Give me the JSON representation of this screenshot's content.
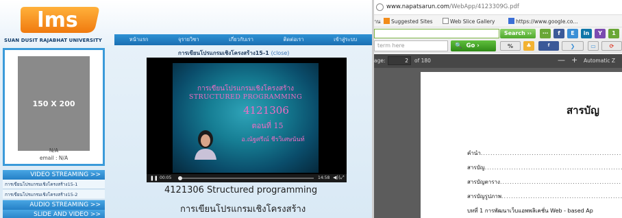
{
  "lms": {
    "logo_text": "lms",
    "university": "SUAN DUSIT RAJABHAT UNIVERSITY",
    "nav": [
      "หน้าแรก",
      "จุรายวิชา",
      "เกี่ยวกับเรา",
      "ติดต่อเรา",
      "เข้าสู่ระบบ"
    ],
    "profile": {
      "placeholder": "150 X 200",
      "name": "N/A",
      "email": "email : N/A"
    },
    "sections": {
      "video_streaming": "VIDEO STREAMING >>",
      "audio_streaming": "AUDIO STREAMING >>",
      "slide_and_video": "SLIDE AND VIDEO >>"
    },
    "video_list": [
      "การเขียนโปรแกรมเชิงโครงสร้าง15-1",
      "การเขียนโปรแกรมเชิงโครงสร้าง15-2"
    ],
    "player": {
      "title": "การเขียนโปรแกรมเชิงโครงสร้าง15-1",
      "close_label": "(close)",
      "slide_lines": [
        "การเขียนโปรแกรมเชิงโครงสร้าง",
        "STRUCTURED PROGRAMMING",
        "4121306",
        "ตอนที่ 15",
        "อ.ณัฐศรีณ์ ชีรวิเศษนันท์"
      ],
      "current_time": "00:05",
      "total_time": "14:58",
      "progress": 0.006
    },
    "course_title_en": "4121306 Structured programming",
    "course_title_th": "การเขียนโปรแกรมเชิงโครงสร้าง"
  },
  "browser": {
    "url_domain": "www.napatsarun.com",
    "url_path": "/WebApp/4123309G.pdf",
    "favorites": [
      "าน",
      "Suggested Sites",
      "Web Slice Gallery",
      "https://www.google.co..."
    ],
    "search_button": "Search",
    "search_placeholder": "term here",
    "go_button": "Go",
    "pdf": {
      "page_label": "age:",
      "page_value": "2",
      "page_total": "of 180",
      "zoom_out": "—",
      "zoom_in": "+",
      "zoom_value": "Automatic Z",
      "heading": "สารบัญ",
      "toc": [
        "คำนำ",
        "สารบัญ",
        "สารบัญตาราง",
        "สารบัญรูปภาพ",
        "บทที่ 1 การพัฒนาเว็บแอพพลิเคชั่น  Web - based Ap"
      ]
    }
  }
}
